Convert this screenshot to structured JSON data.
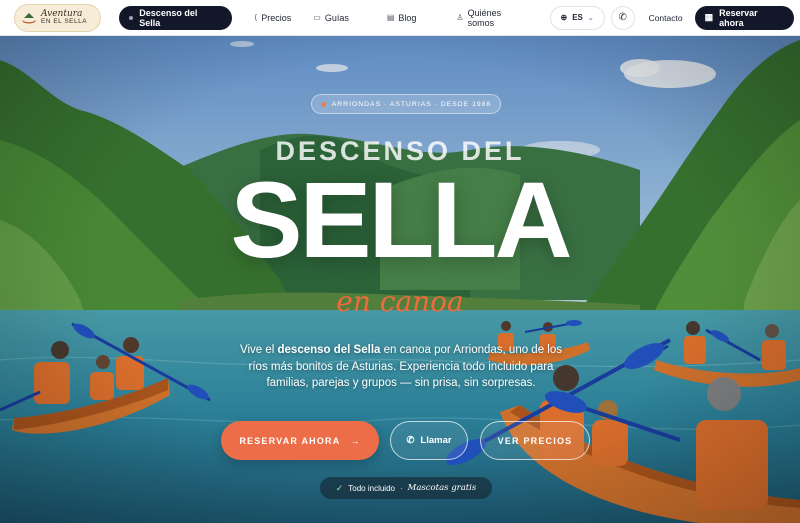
{
  "nav": {
    "logo_line1": "Aventura",
    "logo_line2": "EN EL SELLA",
    "active_item": "Descenso del Sella",
    "links": [
      "Precios",
      "Guías",
      "Blog",
      "Quiénes somos"
    ],
    "language": "ES",
    "contact_label": "Contacto",
    "book_label": "Reservar ahora"
  },
  "hero": {
    "badge": "ARRIONDAS · ASTURIAS · DESDE 1988",
    "pre_title": "DESCENSO DEL",
    "title": "SELLA",
    "script": "en canoa",
    "desc_prefix": "Vive el",
    "desc_bold": "descenso del Sella",
    "desc_suffix": "en canoa por Arriondas, uno de los ríos más bonitos de Asturias. Experiencia todo incluido para familias, parejas y grupos — sin prisa, sin sorpresas.",
    "cta_primary": "RESERVAR AHORA",
    "cta_call": "Llamar",
    "cta_prices": "VER PRECIOS",
    "chip_text": "Todo incluido",
    "chip_sep": "·",
    "chip_italic": "Mascotas gratis"
  },
  "colors": {
    "accent": "#ec6d47",
    "nav_dark": "#12182a",
    "water": "#2f8aa3",
    "kayak": "#e27a2c"
  },
  "icons": {
    "nav_links": [
      "tag-icon",
      "book-icon",
      "document-icon",
      "user-icon"
    ],
    "language": "globe-icon",
    "phone": "phone-icon",
    "book": "calendar-icon",
    "cta_primary": "arrow-right-icon",
    "chip": "check-icon"
  }
}
